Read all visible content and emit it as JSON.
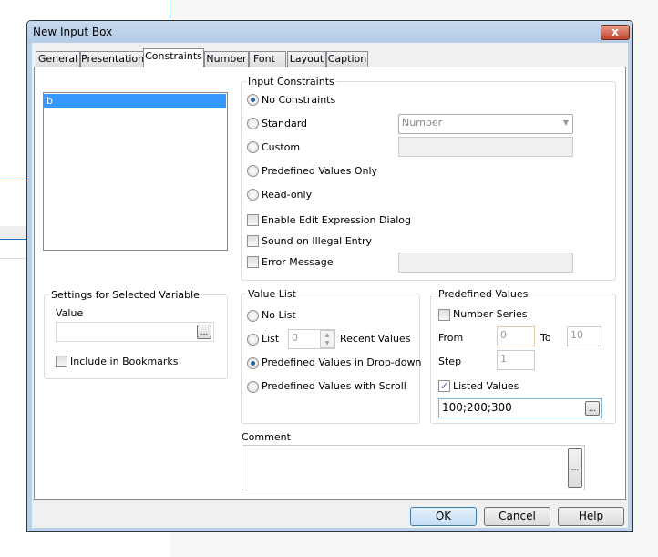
{
  "window": {
    "title": "New Input Box",
    "close": "x"
  },
  "tabs": [
    "General",
    "Presentation",
    "Constraints",
    "Number",
    "Font",
    "Layout",
    "Caption"
  ],
  "selected_tab": "Constraints",
  "variables": [
    "b"
  ],
  "input_constraints": {
    "label": "Input Constraints",
    "options": [
      "No Constraints",
      "Standard",
      "Custom",
      "Predefined Values Only",
      "Read-only"
    ],
    "selected": "No Constraints",
    "standard_value": "Number",
    "checks": [
      {
        "label": "Enable Edit Expression Dialog",
        "checked": false
      },
      {
        "label": "Sound on Illegal Entry",
        "checked": false
      },
      {
        "label": "Error Message",
        "checked": false
      }
    ]
  },
  "settings": {
    "label": "Settings for Selected Variable",
    "value_label": "Value",
    "value": "",
    "ellipsis": "...",
    "include_bookmarks": "Include in Bookmarks"
  },
  "value_list": {
    "label": "Value List",
    "options": [
      "No List",
      "List",
      "Predefined Values in Drop-down",
      "Predefined Values with Scroll"
    ],
    "selected": "Predefined Values in Drop-down",
    "list_count": "0",
    "recent_values": "Recent Values"
  },
  "predefined": {
    "label": "Predefined Values",
    "number_series": "Number Series",
    "from_label": "From",
    "from": "0",
    "to_label": "To",
    "to": "10",
    "step_label": "Step",
    "step": "1",
    "listed_values": "Listed Values",
    "listed_checked": true,
    "listed": "100;200;300"
  },
  "comment": {
    "label": "Comment",
    "value": ""
  },
  "buttons": {
    "ok": "OK",
    "cancel": "Cancel",
    "help": "Help"
  }
}
